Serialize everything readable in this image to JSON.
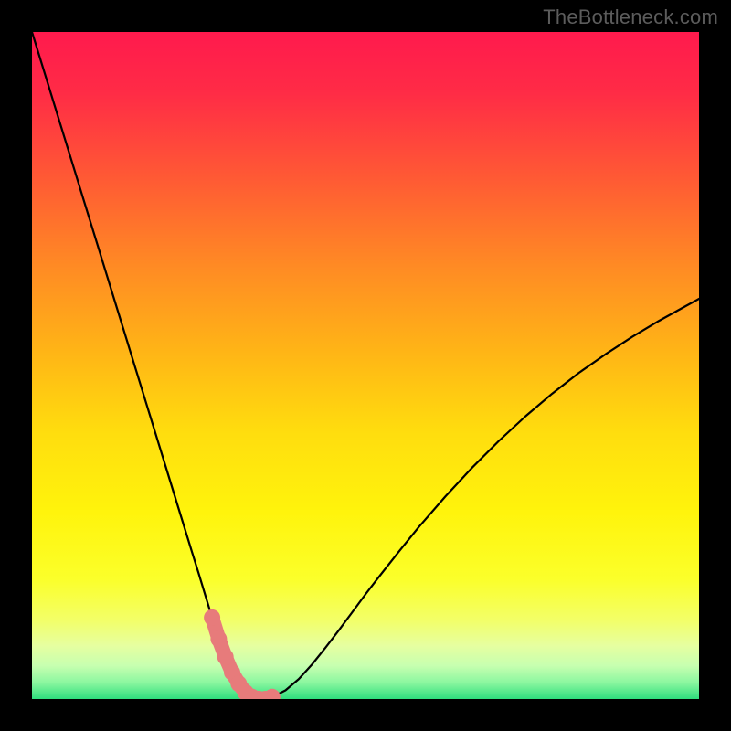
{
  "watermark": "TheBottleneck.com",
  "chart_data": {
    "type": "line",
    "title": "",
    "xlabel": "",
    "ylabel": "",
    "xlim": [
      0,
      100
    ],
    "ylim": [
      0,
      100
    ],
    "x": [
      0,
      2,
      4,
      6,
      8,
      10,
      12,
      14,
      16,
      18,
      20,
      22,
      24,
      25,
      26,
      27,
      28,
      29,
      30,
      31,
      32,
      33,
      34,
      35,
      36,
      38,
      40,
      42,
      44,
      46,
      48,
      50,
      52,
      55,
      58,
      62,
      66,
      70,
      74,
      78,
      82,
      86,
      90,
      94,
      98,
      100
    ],
    "values": [
      100,
      93.5,
      87.0,
      80.5,
      74.0,
      67.5,
      61.0,
      54.5,
      48.0,
      41.5,
      35.0,
      28.5,
      22.0,
      18.8,
      15.5,
      12.2,
      9.0,
      6.3,
      4.0,
      2.3,
      1.0,
      0.3,
      0.0,
      0.0,
      0.3,
      1.3,
      3.0,
      5.2,
      7.7,
      10.3,
      13.0,
      15.7,
      18.3,
      22.1,
      25.8,
      30.4,
      34.7,
      38.7,
      42.4,
      45.8,
      48.9,
      51.7,
      54.3,
      56.7,
      58.9,
      60.0
    ],
    "curve_minimum_x": 34,
    "data_marker_style": "salmon-dots",
    "data_marker_x_range": [
      27,
      37
    ],
    "background_gradient_stops": [
      {
        "pos": 0.0,
        "color": "#ff1a4d"
      },
      {
        "pos": 0.09,
        "color": "#ff2b46"
      },
      {
        "pos": 0.22,
        "color": "#ff5a34"
      },
      {
        "pos": 0.35,
        "color": "#ff8a24"
      },
      {
        "pos": 0.48,
        "color": "#ffb516"
      },
      {
        "pos": 0.6,
        "color": "#ffdd0e"
      },
      {
        "pos": 0.72,
        "color": "#fff40c"
      },
      {
        "pos": 0.82,
        "color": "#fbff2a"
      },
      {
        "pos": 0.88,
        "color": "#f3ff66"
      },
      {
        "pos": 0.92,
        "color": "#e6ffa0"
      },
      {
        "pos": 0.95,
        "color": "#c7ffb0"
      },
      {
        "pos": 0.975,
        "color": "#8cf7a0"
      },
      {
        "pos": 1.0,
        "color": "#2fde7d"
      }
    ]
  }
}
